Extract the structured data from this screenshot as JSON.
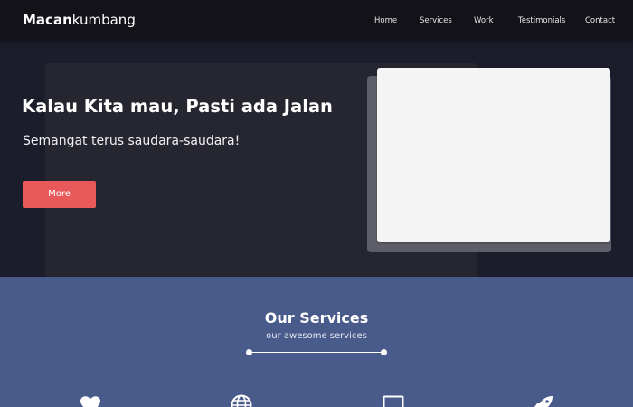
{
  "brand": {
    "bold": "Macan",
    "light": "kumbang"
  },
  "nav": [
    {
      "label": "Home"
    },
    {
      "label": "Services"
    },
    {
      "label": "Work"
    },
    {
      "label": "Testimonials"
    },
    {
      "label": "Contact"
    }
  ],
  "hero": {
    "title": "Kalau Kita mau, Pasti ada Jalan",
    "subtitle": "Semangat terus saudara-saudara!",
    "button": "More"
  },
  "services": {
    "title": "Our Services",
    "subtitle": "our awesome services",
    "icons": [
      "heart-icon",
      "globe-icon",
      "monitor-icon",
      "rocket-icon"
    ]
  },
  "colors": {
    "navbar": "#141219",
    "hero_bg": "#1c1d2b",
    "accent": "#e9595a",
    "services_bg": "#495b8b"
  }
}
